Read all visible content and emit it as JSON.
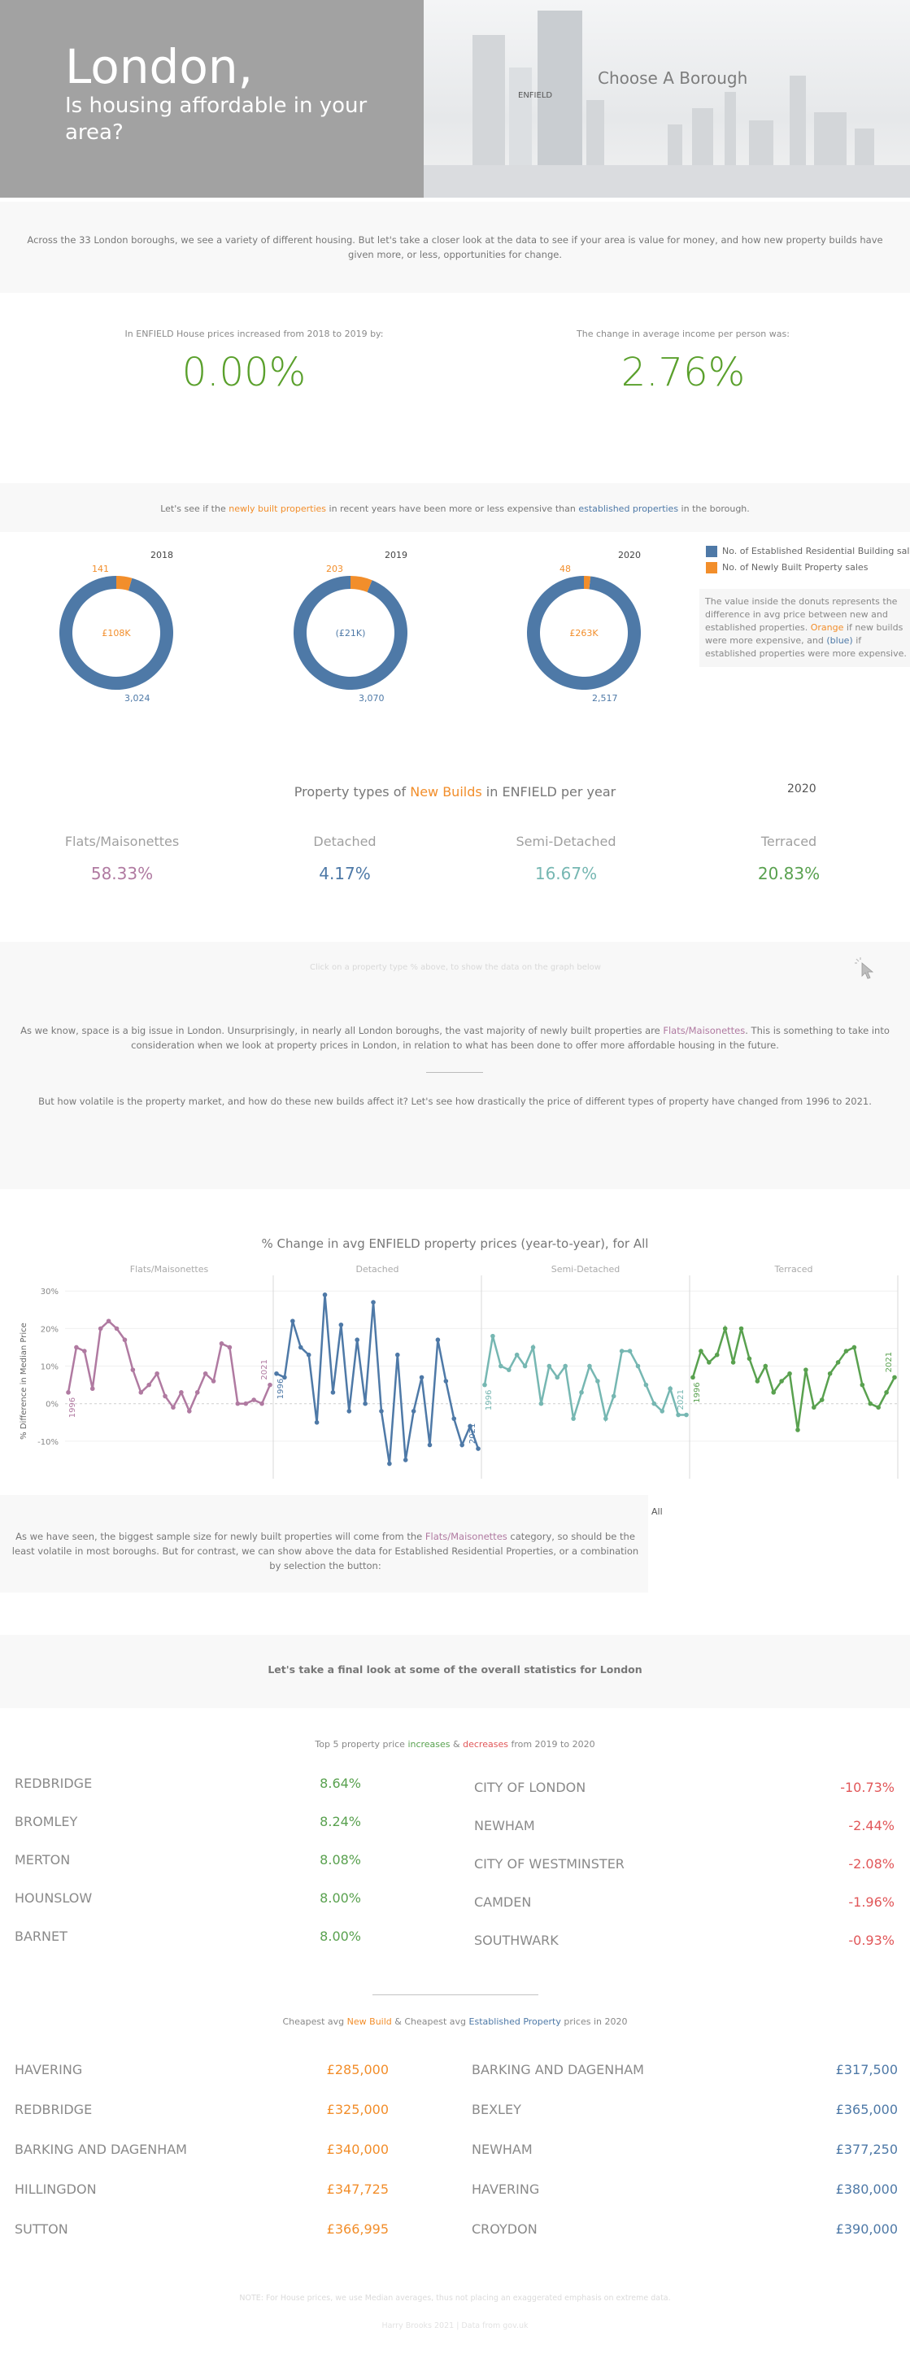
{
  "header": {
    "title": "London,",
    "subtitle": "Is housing affordable in your area?",
    "borough_label": "ENFIELD",
    "choose_label": "Choose A Borough"
  },
  "intro": "Across the 33 London boroughs, we see a variety of different housing. But let's take a closer look at the data to see if your area is value for money, and how new property builds have given more, or less, opportunities for change.",
  "kpis": {
    "left_label": "In ENFIELD House prices increased from 2018 to 2019 by:",
    "left_value": "0.00%",
    "right_label": "The change in average income per person was:",
    "right_value": "2.76%"
  },
  "donut_intro": {
    "pre": "Let's see if the ",
    "new": "newly built properties",
    "mid": " in recent years have been more or less expensive than ",
    "est": "established properties",
    "post": " in the borough."
  },
  "donuts": [
    {
      "year": "2018",
      "new_sales": 141,
      "established_sales": 3024,
      "center": "£108K",
      "center_color": "#f28e2b"
    },
    {
      "year": "2019",
      "new_sales": 203,
      "established_sales": 3070,
      "center": "(£21K)",
      "center_color": "#4e79a7"
    },
    {
      "year": "2020",
      "new_sales": 48,
      "established_sales": 2517,
      "center": "£263K",
      "center_color": "#f28e2b"
    }
  ],
  "donut_labels": [
    {
      "new": "141",
      "est": "3,024"
    },
    {
      "new": "203",
      "est": "3,070"
    },
    {
      "new": "48",
      "est": "2,517"
    }
  ],
  "legend": {
    "established": "No. of Established Residential Building sal..",
    "new": "No. of Newly Built Property sales",
    "established_color": "#4e79a7",
    "new_color": "#f28e2b",
    "note_a": "The value inside the donuts represents the difference in avg price between new and established properties. ",
    "note_orange": "Orange",
    "note_b": " if new builds were more expensive, and ",
    "note_blue": "(blue)",
    "note_c": " if established properties were more expensive."
  },
  "types": {
    "title_pre": "Property types of ",
    "title_new": "New Builds",
    "title_post": " in ENFIELD per year",
    "year": "2020",
    "items": [
      {
        "name": "Flats/Maisonettes",
        "value": "58.33%",
        "color": "#b07aa1"
      },
      {
        "name": "Detached",
        "value": "4.17%",
        "color": "#4e79a7"
      },
      {
        "name": "Semi-Detached",
        "value": "16.67%",
        "color": "#76b7b2"
      },
      {
        "name": "Terraced",
        "value": "20.83%",
        "color": "#59a14f"
      }
    ],
    "hint": "Click on a property type % above, to show the data on the graph below"
  },
  "story": {
    "p1_pre": "As we know, space is a big issue in London. Unsurprisingly, in nearly all London boroughs, the vast majority of newly built properties are ",
    "p1_flats": "Flats/Maisonettes",
    "p1_post": ". This is something to take into consideration when we look at property prices in London, in relation to what has been done to offer more affordable housing in the future.",
    "p2": "But how volatile is the property market, and how do these new builds affect it? Let's see how drastically the price of different types of property have changed from 1996 to 2021."
  },
  "chart_data": {
    "type": "line",
    "title": "% Change in avg ENFIELD property prices (year-to-year), for All",
    "ylabel": "% Difference in Median Price",
    "ylim": [
      -20,
      32
    ],
    "y_ticks": [
      "30%",
      "20%",
      "10%",
      "0%",
      "-10%"
    ],
    "x": [
      1996,
      1997,
      1998,
      1999,
      2000,
      2001,
      2002,
      2003,
      2004,
      2005,
      2006,
      2007,
      2008,
      2009,
      2010,
      2011,
      2012,
      2013,
      2014,
      2015,
      2016,
      2017,
      2018,
      2019,
      2020,
      2021
    ],
    "series": [
      {
        "name": "Flats/Maisonettes",
        "color": "#b07aa1",
        "start_label": "1996",
        "end_label": "2021",
        "values": [
          3,
          15,
          14,
          4,
          20,
          22,
          20,
          17,
          9,
          3,
          5,
          8,
          2,
          -1,
          3,
          -2,
          3,
          8,
          6,
          16,
          15,
          0,
          0,
          1,
          0,
          5
        ]
      },
      {
        "name": "Detached",
        "color": "#4e79a7",
        "start_label": "1996",
        "end_label": "2021",
        "values": [
          8,
          7,
          22,
          15,
          13,
          -5,
          29,
          3,
          21,
          -2,
          17,
          0,
          27,
          -2,
          -16,
          13,
          -15,
          -2,
          7,
          -11,
          17,
          6,
          -4,
          -11,
          -6,
          -12
        ]
      },
      {
        "name": "Semi-Detached",
        "color": "#76b7b2",
        "start_label": "1996",
        "end_label": "2021",
        "values": [
          5,
          18,
          10,
          9,
          13,
          10,
          15,
          0,
          10,
          7,
          10,
          -4,
          3,
          10,
          6,
          -4,
          2,
          14,
          14,
          10,
          5,
          0,
          -2,
          4,
          -3,
          -3
        ]
      },
      {
        "name": "Terraced",
        "color": "#59a14f",
        "start_label": "1996",
        "end_label": "2021",
        "values": [
          7,
          14,
          11,
          13,
          20,
          11,
          20,
          12,
          6,
          10,
          3,
          6,
          8,
          -7,
          9,
          -1,
          1,
          8,
          11,
          14,
          15,
          5,
          0,
          -1,
          3,
          7
        ]
      }
    ]
  },
  "chart_note": {
    "pre": "As we have seen, the biggest sample size for newly built properties will come from the ",
    "flats": "Flats/Maisonettes",
    "post": " category, so should be the least volatile in most boroughs. But for contrast, we can show above the data for Established Residential Properties, or a combination by selection the button:",
    "button": "All"
  },
  "final": {
    "heading": "Let's take a final look at some of the overall statistics for London",
    "top5_pre": "Top 5 property price ",
    "top5_inc": "increases",
    "top5_and": " & ",
    "top5_dec": "decreases",
    "top5_post": " from  2019 to 2020",
    "increases": [
      {
        "name": "REDBRIDGE",
        "value": "8.64%"
      },
      {
        "name": "BROMLEY",
        "value": "8.24%"
      },
      {
        "name": "MERTON",
        "value": "8.08%"
      },
      {
        "name": "HOUNSLOW",
        "value": "8.00%"
      },
      {
        "name": "BARNET",
        "value": "8.00%"
      }
    ],
    "decreases": [
      {
        "name": "CITY OF LONDON",
        "value": "-10.73%"
      },
      {
        "name": "NEWHAM",
        "value": "-2.44%"
      },
      {
        "name": "CITY OF WESTMINSTER",
        "value": "-2.08%"
      },
      {
        "name": "CAMDEN",
        "value": "-1.96%"
      },
      {
        "name": "SOUTHWARK",
        "value": "-0.93%"
      }
    ],
    "cheap_pre": "Cheapest avg ",
    "cheap_new": "New Build",
    "cheap_and": " & Cheapest avg ",
    "cheap_est": "Established Property",
    "cheap_post": " prices in 2020",
    "cheap_new_list": [
      {
        "name": "HAVERING",
        "value": "£285,000"
      },
      {
        "name": "REDBRIDGE",
        "value": "£325,000"
      },
      {
        "name": "BARKING AND DAGENHAM",
        "value": "£340,000"
      },
      {
        "name": "HILLINGDON",
        "value": "£347,725"
      },
      {
        "name": "SUTTON",
        "value": "£366,995"
      }
    ],
    "cheap_est_list": [
      {
        "name": "BARKING AND DAGENHAM",
        "value": "£317,500"
      },
      {
        "name": "BEXLEY",
        "value": "£365,000"
      },
      {
        "name": "NEWHAM",
        "value": "£377,250"
      },
      {
        "name": "HAVERING",
        "value": "£380,000"
      },
      {
        "name": "CROYDON",
        "value": "£390,000"
      }
    ],
    "footnote": "NOTE: For House prices, we use Median averages, thus not placing an exaggerated emphasis on extreme data.",
    "credit": "Harry Brooks 2021 | Data from gov.uk"
  }
}
